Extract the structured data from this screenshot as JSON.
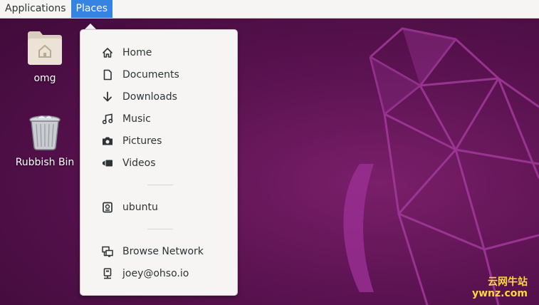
{
  "topbar": {
    "applications_label": "Applications",
    "places_label": "Places"
  },
  "desktop": {
    "icons": [
      {
        "label": "omg",
        "icon": "home-folder-icon"
      },
      {
        "label": "Rubbish Bin",
        "icon": "trash-icon"
      }
    ]
  },
  "places_menu": {
    "items": [
      {
        "label": "Home",
        "icon": "home-icon"
      },
      {
        "label": "Documents",
        "icon": "document-icon"
      },
      {
        "label": "Downloads",
        "icon": "download-icon"
      },
      {
        "label": "Music",
        "icon": "music-icon"
      },
      {
        "label": "Pictures",
        "icon": "camera-icon"
      },
      {
        "label": "Videos",
        "icon": "video-icon"
      }
    ],
    "drives": [
      {
        "label": "ubuntu",
        "icon": "drive-icon"
      }
    ],
    "network": [
      {
        "label": "Browse Network",
        "icon": "network-icon"
      },
      {
        "label": "joey@ohso.io",
        "icon": "network-server-icon"
      }
    ]
  },
  "watermark": {
    "line1": "云网牛站",
    "line2": "ywnz.com"
  },
  "colors": {
    "accent": "#3584e4",
    "wallpaper": "#5a1250",
    "menu_bg": "#f6f5f4"
  }
}
